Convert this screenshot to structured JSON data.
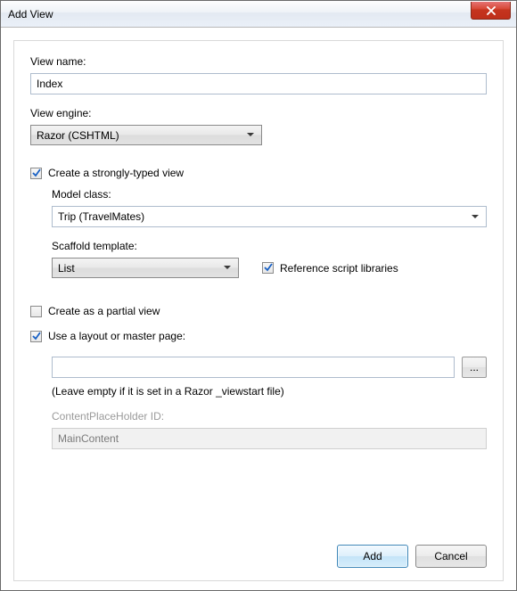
{
  "window": {
    "title": "Add View"
  },
  "view_name": {
    "label": "View name:",
    "value": "Index"
  },
  "view_engine": {
    "label": "View engine:",
    "value": "Razor (CSHTML)"
  },
  "strongly_typed": {
    "checked": true,
    "label": "Create a strongly-typed view",
    "model_class": {
      "label": "Model class:",
      "value": "Trip (TravelMates)"
    },
    "scaffold": {
      "label": "Scaffold template:",
      "value": "List"
    },
    "ref_scripts": {
      "checked": true,
      "label": "Reference script libraries"
    }
  },
  "partial_view": {
    "checked": false,
    "label": "Create as a partial view"
  },
  "layout": {
    "checked": true,
    "label": "Use a layout or master page:",
    "value": "",
    "browse_label": "...",
    "hint": "(Leave empty if it is set in a Razor _viewstart file)",
    "cph_label": "ContentPlaceHolder ID:",
    "cph_value": "MainContent"
  },
  "buttons": {
    "add": "Add",
    "cancel": "Cancel"
  }
}
